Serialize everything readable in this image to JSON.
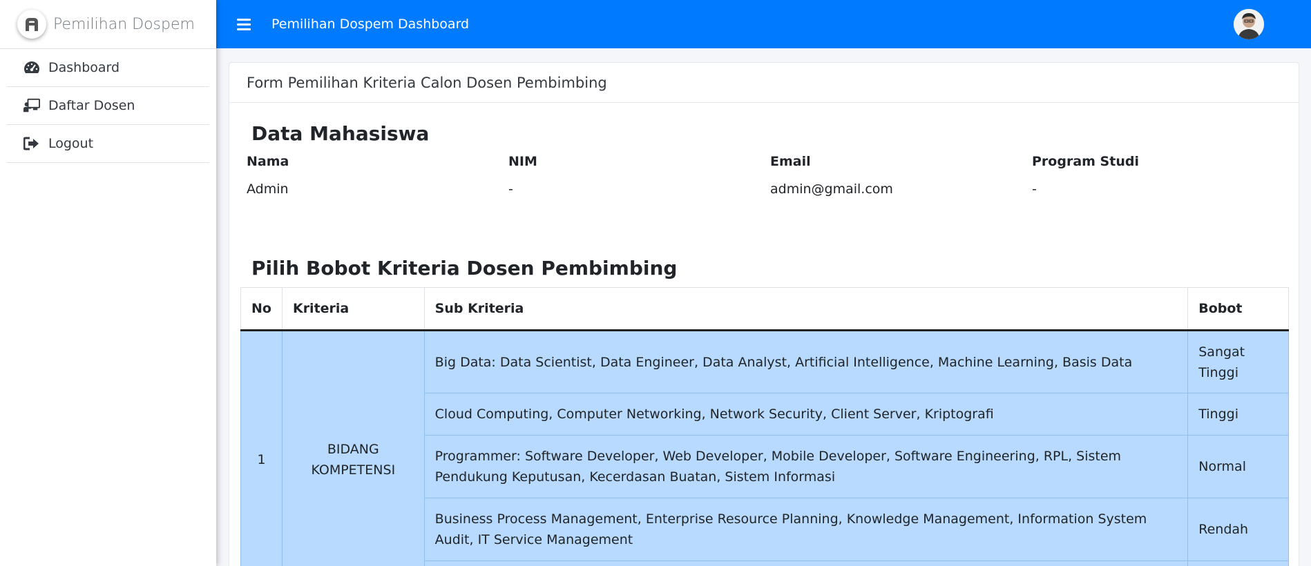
{
  "brand": {
    "name": "Pemilihan Dospem"
  },
  "sidebar": {
    "items": [
      {
        "label": "Dashboard",
        "icon": "dashboard-gauge-icon"
      },
      {
        "label": "Daftar Dosen",
        "icon": "teacher-board-icon"
      },
      {
        "label": "Logout",
        "icon": "sign-out-icon"
      }
    ]
  },
  "topbar": {
    "title": "Pemilihan Dospem Dashboard"
  },
  "card": {
    "header": "Form Pemilihan Kriteria Calon Dosen Pembimbing",
    "student_section_title": "Data Mahasiswa",
    "student": {
      "headers": [
        "Nama",
        "NIM",
        "Email",
        "Program Studi"
      ],
      "values": [
        "Admin",
        "-",
        "admin@gmail.com",
        "-"
      ]
    },
    "criteria_section_title": "Pilih Bobot Kriteria Dosen Pembimbing",
    "table": {
      "headers": [
        "No",
        "Kriteria",
        "Sub Kriteria",
        "Bobot"
      ],
      "group": {
        "no": "1",
        "kriteria": "BIDANG KOMPETENSI"
      },
      "rows": [
        {
          "sub": "Big Data: Data Scientist, Data Engineer, Data Analyst, Artificial Intelligence, Machine Learning, Basis Data",
          "bobot": "Sangat Tinggi"
        },
        {
          "sub": "Cloud Computing, Computer Networking, Network Security, Client Server, Kriptografi",
          "bobot": "Tinggi"
        },
        {
          "sub": "Programmer: Software Developer, Web Developer, Mobile Developer, Software Engineering, RPL, Sistem Pendukung Keputusan, Kecerdasan Buatan, Sistem Informasi",
          "bobot": "Normal"
        },
        {
          "sub": "Business Process Management, Enterprise Resource Planning, Knowledge Management, Information System Audit, IT Service Management",
          "bobot": "Rendah"
        }
      ]
    }
  },
  "colors": {
    "topbar": "#007bff",
    "row_highlight": "#b8daff"
  }
}
